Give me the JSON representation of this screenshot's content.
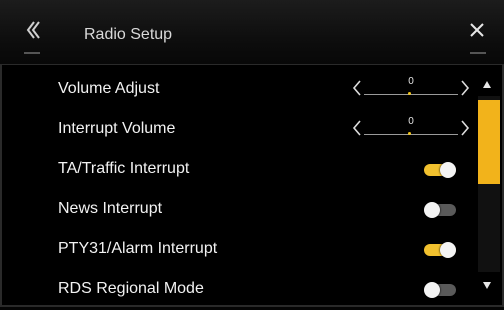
{
  "header": {
    "title": "Radio Setup",
    "back_icon": "double-chevron-left-icon",
    "close_icon": "close-icon"
  },
  "rows": [
    {
      "label": "Volume Adjust",
      "type": "stepper",
      "value": "0"
    },
    {
      "label": "Interrupt Volume",
      "type": "stepper",
      "value": "0"
    },
    {
      "label": "TA/Traffic Interrupt",
      "type": "toggle",
      "state": "on"
    },
    {
      "label": "News Interrupt",
      "type": "toggle",
      "state": "off"
    },
    {
      "label": "PTY31/Alarm Interrupt",
      "type": "toggle",
      "state": "on"
    },
    {
      "label": "RDS Regional Mode",
      "type": "toggle",
      "state": "off"
    }
  ],
  "scrollbar": {
    "up_icon": "triangle-up-icon",
    "down_icon": "triangle-down-icon"
  },
  "colors": {
    "accent": "#f2c12e",
    "scroll_thumb": "#f2b31b",
    "background": "#000000"
  }
}
